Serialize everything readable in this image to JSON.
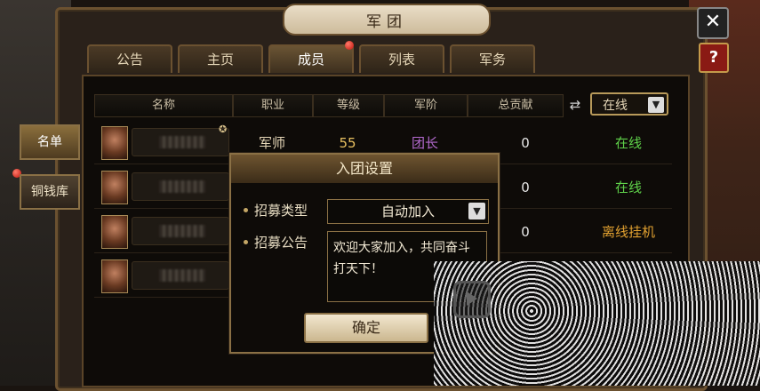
{
  "window": {
    "title": "军团",
    "close_label": "✕",
    "help_label": "?"
  },
  "tabs": [
    "公告",
    "主页",
    "成员",
    "列表",
    "军务"
  ],
  "active_tab_index": 2,
  "sidebar": {
    "items": [
      "名单",
      "铜钱库"
    ]
  },
  "table": {
    "headers": [
      "名称",
      "职业",
      "等级",
      "军阶",
      "总贡献"
    ],
    "filter": {
      "selected": "在线"
    },
    "rows": [
      {
        "profession": "军师",
        "level": "55",
        "rank": "团长",
        "contribution": "0",
        "status": "在线"
      },
      {
        "profession": "",
        "level": "",
        "rank": "",
        "contribution": "0",
        "status": "在线"
      },
      {
        "profession": "",
        "level": "",
        "rank": "",
        "contribution": "0",
        "status": "离线挂机"
      },
      {
        "profession": "",
        "level": "",
        "rank": "",
        "contribution": "",
        "status": ""
      }
    ]
  },
  "dialog": {
    "title": "入团设置",
    "recruit_type_label": "招募类型",
    "recruit_type_value": "自动加入",
    "recruit_notice_label": "招募公告",
    "recruit_notice_text": "欢迎大家加入，共同奋斗打天下！",
    "confirm_label": "确定"
  },
  "colors": {
    "online": "#5fd24a",
    "offline": "#e0a030",
    "rank": "#b46ad0",
    "level": "#e8c060"
  }
}
